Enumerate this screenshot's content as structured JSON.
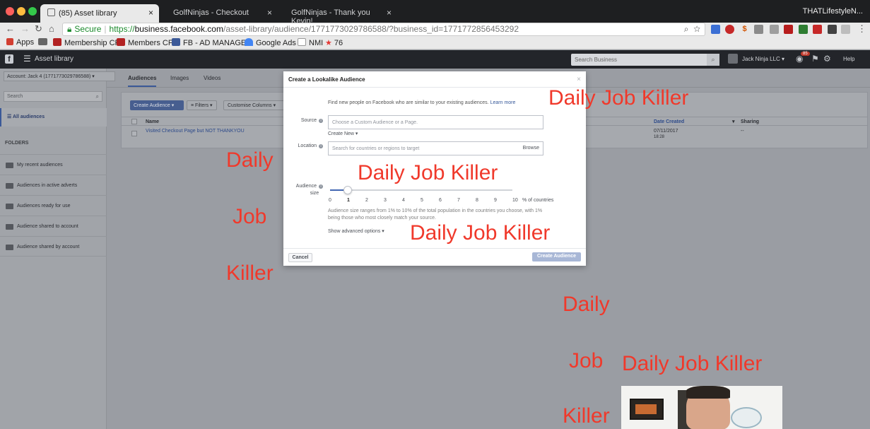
{
  "browser": {
    "tabs": [
      {
        "label": "(85) Asset library",
        "active": true
      },
      {
        "label": "GolfNinjas - Checkout",
        "active": false
      },
      {
        "label": "GolfNinjas - Thank you Kevin!",
        "active": false
      }
    ],
    "profile": "THATLifestyleN...",
    "address": {
      "secure_label": "Secure",
      "scheme": "https://",
      "host": "business.facebook.com",
      "path": "/asset-library/audience/1771773029786588/?business_id=1771772856453292"
    },
    "bookmarks": [
      {
        "label": "Apps",
        "icon": "apps-grid-icon",
        "color": "#d23f31"
      },
      {
        "label": "",
        "icon": "folder-icon",
        "color": "#555555"
      },
      {
        "label": "Membership CF",
        "icon": "cf-icon",
        "color": "#b22222"
      },
      {
        "label": "Members CF",
        "icon": "cf-icon",
        "color": "#b22222"
      },
      {
        "label": "FB - AD MANAGER",
        "icon": "page-icon",
        "color": "#3b5998"
      },
      {
        "label": "Google Ads",
        "icon": "google-ads-icon",
        "color": "#4285f4"
      },
      {
        "label": "NMI",
        "icon": "page-icon",
        "color": "#777777"
      },
      {
        "label": "76",
        "icon": "star-icon",
        "color": "#e53935"
      }
    ]
  },
  "fb": {
    "section": "Asset library",
    "search_placeholder": "Search Business",
    "account_name": "Jack Ninja LLC",
    "notification_count": "85",
    "help": "Help"
  },
  "sidebar": {
    "account_select": "Account: Jack 4 (1771773029786588)",
    "search_placeholder": "Search",
    "all_audiences": "All audiences",
    "folders_heading": "FOLDERS",
    "folders": [
      "My recent audiences",
      "Audiences in active adverts",
      "Audiences ready for use",
      "Audience shared to account",
      "Audience shared by account"
    ]
  },
  "main": {
    "tabs": [
      "Audiences",
      "Images",
      "Videos"
    ],
    "toolbar": {
      "create": "Create Audience",
      "filters": "Filters",
      "columns": "Customise Columns"
    },
    "columns": {
      "name": "Name",
      "date_created": "Date Created",
      "sharing": "Sharing"
    },
    "row": {
      "name": "Visited Checkout Page but NOT THANKYOU",
      "date": "07/11/2017",
      "time": "18:28",
      "sharing": "--"
    }
  },
  "modal": {
    "title": "Create a Lookalike Audience",
    "description": "Find new people on Facebook who are similar to your existing audiences.",
    "learn_more": "Learn more",
    "source_label": "Source",
    "source_placeholder": "Choose a Custom Audience or a Page.",
    "create_new": "Create New",
    "location_label": "Location",
    "location_placeholder": "Search for countries or regions to target",
    "browse": "Browse",
    "audience_label": "Audience",
    "size_label": "size",
    "slider_value": 1,
    "ticks": [
      "0",
      "1",
      "2",
      "3",
      "4",
      "5",
      "6",
      "7",
      "8",
      "9",
      "10"
    ],
    "ticks_unit": "% of countries",
    "help_text": "Audience size ranges from 1% to 10% of the total population in the countries you choose, with 1% being those who most closely match your source.",
    "advanced": "Show advanced options",
    "cancel": "Cancel",
    "create": "Create Audience"
  },
  "watermarks": {
    "full": "Daily Job Killer",
    "daily": "Daily",
    "job": "Job",
    "killer": "Killer"
  },
  "colors": {
    "watermark": "#f0392b",
    "fb_blue": "#4267b2",
    "secure_green": "#1a8a2b"
  }
}
